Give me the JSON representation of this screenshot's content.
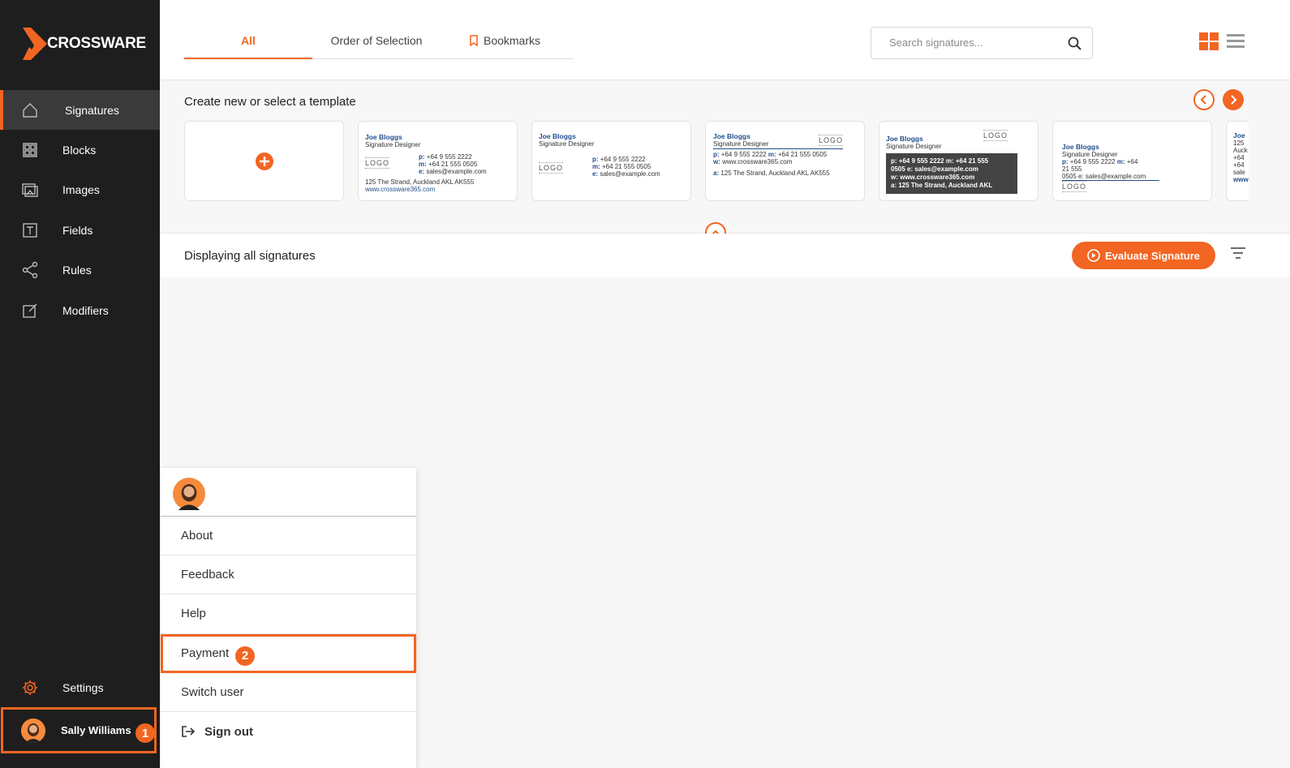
{
  "brand": {
    "name": "CROSSWARE",
    "accent": "#f26522"
  },
  "sidebar": {
    "items": [
      {
        "label": "Signatures",
        "icon": "home-icon",
        "active": true
      },
      {
        "label": "Blocks",
        "icon": "blocks-icon"
      },
      {
        "label": "Images",
        "icon": "images-icon"
      },
      {
        "label": "Fields",
        "icon": "fields-icon"
      },
      {
        "label": "Rules",
        "icon": "rules-icon"
      },
      {
        "label": "Modifiers",
        "icon": "modifiers-icon"
      }
    ],
    "settings_label": "Settings",
    "user_name": "Sally Williams",
    "user_badge": "1"
  },
  "tabs": [
    {
      "label": "All",
      "active": true
    },
    {
      "label": "Order of Selection"
    },
    {
      "label": "Bookmarks",
      "icon": "bookmark-icon"
    }
  ],
  "search": {
    "placeholder": "Search signatures..."
  },
  "templates": {
    "title": "Create new or select a template",
    "cards": [
      {
        "name": "Joe Bloggs",
        "role": "Signature Designer",
        "phone": "+64 9 555 2222",
        "mobile": "+64 21 555 0505",
        "email": "sales@example.com",
        "address": "125 The Strand, Auckland AKL AK555",
        "web": "www.crossware365.com",
        "logo": "LOGO"
      },
      {
        "name": "Joe Bloggs",
        "role": "Signature Designer",
        "phone": "+64 9 555 2222",
        "mobile": "+64 21 555 0505",
        "email": "sales@example.com",
        "logo": "LOGO"
      },
      {
        "name": "Joe Bloggs",
        "role": "Signature Designer",
        "line1": "+64 9 555 2222",
        "line1b": "+64 21 555 0505",
        "web": "www.crossware365.com",
        "address": "125 The Strand, Auckland AKL AK555",
        "logo": "LOGO"
      },
      {
        "name": "Joe Bloggs",
        "role": "Signature Designer",
        "line1": "p: +64 9 555 2222 m: +64 21 555",
        "line2": "0505 e: sales@example.com",
        "line3": "w: www.crossware365.com",
        "line4": "a: 125 The Strand, Auckland AKL",
        "logo": "LOGO"
      },
      {
        "name": "Joe Bloggs",
        "role": "Signature Designer",
        "phone": "+64 9 555 2222",
        "mobile": "+64",
        "mobile2": "21 555",
        "email": "0505 e: sales@example.com",
        "logo": "LOGO"
      },
      {
        "name": "Joe",
        "role": "125 ",
        "extra1": "Auck",
        "extra2": "+64 ",
        "extra3": "+64 ",
        "extra4": "sale",
        "extra5": "www"
      }
    ]
  },
  "list": {
    "title": "Displaying all signatures",
    "evaluate_label": "Evaluate Signature"
  },
  "user_menu": {
    "items": [
      "About",
      "Feedback",
      "Help",
      "Payment",
      "Switch user",
      "Sign out"
    ],
    "payment_badge": "2"
  }
}
